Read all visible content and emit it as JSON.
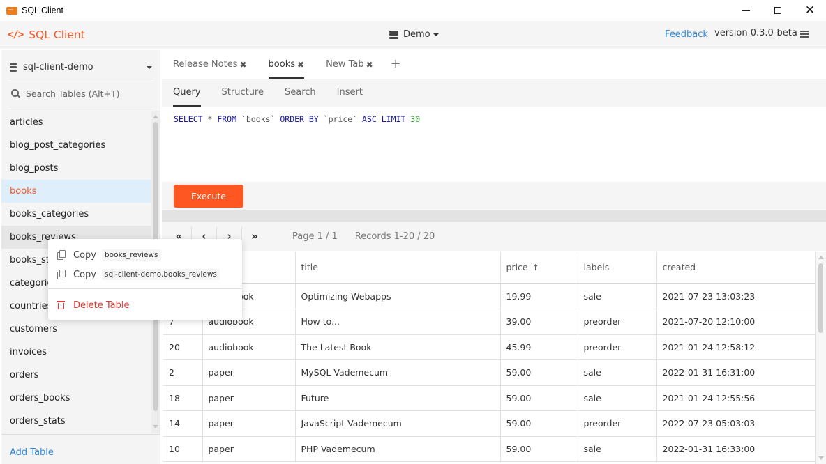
{
  "window": {
    "title": "SQL Client",
    "controls": {
      "minimize": "minimize",
      "maximize": "maximize",
      "close": "close"
    }
  },
  "header": {
    "brand_icon": "code-icon",
    "brand": "SQL Client",
    "connection": "Demo",
    "feedback": "Feedback",
    "version": "version 0.3.0-beta",
    "menu_icon": "hamburger-menu-icon"
  },
  "sidebar": {
    "database": "sql-client-demo",
    "search_placeholder": "Search Tables (Alt+T)",
    "search_value": "",
    "tables": [
      {
        "name": "articles",
        "state": ""
      },
      {
        "name": "blog_post_categories",
        "state": ""
      },
      {
        "name": "blog_posts",
        "state": ""
      },
      {
        "name": "books",
        "state": "active"
      },
      {
        "name": "books_categories",
        "state": ""
      },
      {
        "name": "books_reviews",
        "state": "hover"
      },
      {
        "name": "books_stats",
        "state": ""
      },
      {
        "name": "categories",
        "state": ""
      },
      {
        "name": "countries",
        "state": ""
      },
      {
        "name": "customers",
        "state": ""
      },
      {
        "name": "invoices",
        "state": ""
      },
      {
        "name": "orders",
        "state": ""
      },
      {
        "name": "orders_books",
        "state": ""
      },
      {
        "name": "orders_stats",
        "state": ""
      }
    ],
    "add_table": "Add Table"
  },
  "tabs": [
    {
      "label": "Release Notes",
      "active": false
    },
    {
      "label": "books",
      "active": true
    },
    {
      "label": "New Tab",
      "active": false
    }
  ],
  "tab_add": "+",
  "subtabs": [
    {
      "label": "Query",
      "active": true
    },
    {
      "label": "Structure",
      "active": false
    },
    {
      "label": "Search",
      "active": false
    },
    {
      "label": "Insert",
      "active": false
    }
  ],
  "query": {
    "tokens": [
      {
        "t": "SELECT",
        "c": "kw"
      },
      {
        "t": " * ",
        "c": "op"
      },
      {
        "t": "FROM",
        "c": "kw"
      },
      {
        "t": " `books` ",
        "c": "str"
      },
      {
        "t": "ORDER BY",
        "c": "kw"
      },
      {
        "t": " `price` ",
        "c": "str"
      },
      {
        "t": "ASC LIMIT",
        "c": "kw"
      },
      {
        "t": " 30",
        "c": "num"
      }
    ],
    "text": "SELECT * FROM `books` ORDER BY `price` ASC LIMIT 30"
  },
  "execute": "Execute",
  "pager": {
    "first": "«",
    "prev": "‹",
    "next": "›",
    "last": "»",
    "page": "Page 1 / 1",
    "records": "Records 1-20 / 20"
  },
  "grid": {
    "columns": [
      "",
      "",
      "title",
      "price",
      "labels",
      "created"
    ],
    "sort": {
      "column": "price",
      "direction": "asc"
    },
    "rows": [
      [
        "",
        "audiobook",
        "Optimizing Webapps",
        "19.99",
        "sale",
        "2021-07-23 13:03:23"
      ],
      [
        "7",
        "audiobook",
        "How to...",
        "39.00",
        "preorder",
        "2021-07-20 12:10:00"
      ],
      [
        "20",
        "audiobook",
        "The Latest Book",
        "45.99",
        "preorder",
        "2021-01-24 12:58:12"
      ],
      [
        "2",
        "paper",
        "MySQL Vademecum",
        "59.00",
        "sale",
        "2022-01-31 16:31:00"
      ],
      [
        "18",
        "paper",
        "Future",
        "59.00",
        "sale",
        "2021-01-24 12:55:56"
      ],
      [
        "14",
        "paper",
        "JavaScript Vademecum",
        "59.00",
        "preorder",
        "2022-07-23 05:03:03"
      ],
      [
        "10",
        "paper",
        "PHP Vademecum",
        "59.00",
        "sale",
        "2022-01-31 16:33:00"
      ]
    ]
  },
  "context_menu": {
    "items": [
      {
        "label": "Copy",
        "code": "books_reviews",
        "icon": "copy-icon"
      },
      {
        "label": "Copy",
        "code": "sql-client-demo.books_reviews",
        "icon": "copy-icon"
      }
    ],
    "delete": {
      "label": "Delete Table",
      "icon": "trash-icon"
    }
  },
  "colors": {
    "accent": "#ff5722",
    "brand": "#f25a29",
    "link": "#2f87d8",
    "danger": "#e53935",
    "selected_row": "#deeefa"
  }
}
